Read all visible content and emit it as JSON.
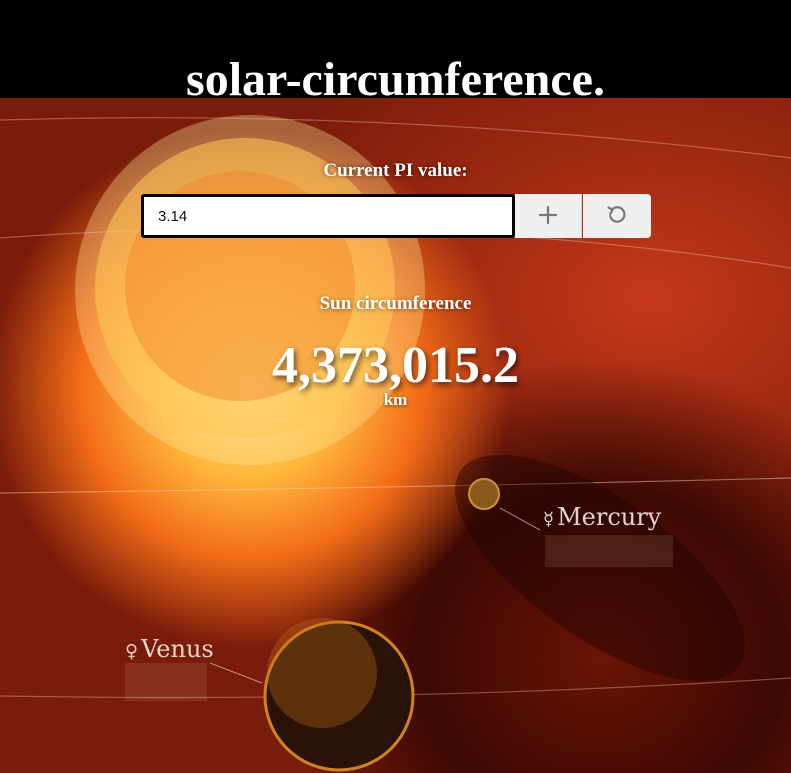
{
  "app": {
    "title": "solar-circumference."
  },
  "pi": {
    "label": "Current PI value:",
    "value": "3.14",
    "add_icon": "plus-icon",
    "reset_icon": "reset-icon"
  },
  "result": {
    "label": "Sun circumference",
    "value": "4,373,015.2",
    "unit": "km"
  },
  "background": {
    "mercury": {
      "symbol": "☿",
      "name": "Mercury"
    },
    "venus": {
      "symbol": "♀",
      "name": "Venus"
    }
  },
  "colors": {
    "header": "#000000",
    "button_bg": "#efefef",
    "text": "#ffffff"
  }
}
